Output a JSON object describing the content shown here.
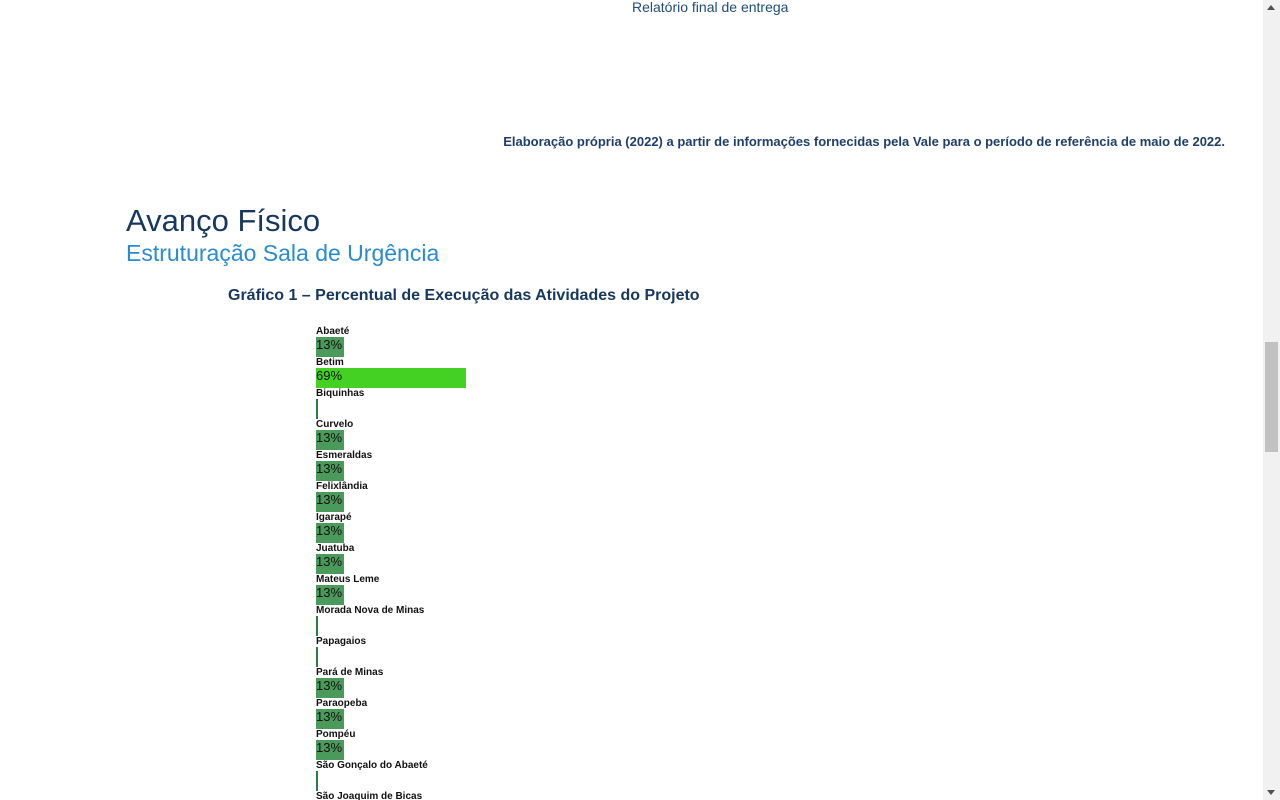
{
  "header": {
    "top_link": "Relatório final de entrega",
    "source_note": "Elaboração própria (2022) a partir de informações fornecidas pela Vale para o período de referência de maio de 2022."
  },
  "section": {
    "title": "Avanço Físico",
    "subtitle": "Estruturação Sala de Urgência"
  },
  "chart_title": "Gráfico 1 – Percentual de Execução das Atividades do Projeto",
  "chart_data": {
    "type": "bar",
    "orientation": "horizontal",
    "categories": [
      "Abaeté",
      "Betim",
      "Biquinhas",
      "Curvelo",
      "Esmeraldas",
      "Felixlândia",
      "Igarapé",
      "Juatuba",
      "Mateus Leme",
      "Morada Nova de Minas",
      "Papagaios",
      "Pará de Minas",
      "Paraopeba",
      "Pompéu",
      "São Gonçalo do Abaeté",
      "São Joaquim de Bicas"
    ],
    "values": [
      13,
      69,
      0,
      13,
      13,
      13,
      13,
      13,
      13,
      0,
      0,
      13,
      13,
      13,
      0,
      0
    ],
    "value_labels": [
      "13%",
      "69%",
      "",
      "13%",
      "13%",
      "13%",
      "13%",
      "13%",
      "13%",
      "",
      "",
      "13%",
      "13%",
      "13%",
      "",
      ""
    ],
    "unit": "%",
    "colors": {
      "default": "#4a9a5c",
      "highlight": "#44d124",
      "zero": "#2e7d45"
    },
    "highlight_index": 1
  },
  "colors": {
    "title": "#17375e",
    "subtitle": "#2a8bd1",
    "note": "#1f3f6b"
  }
}
